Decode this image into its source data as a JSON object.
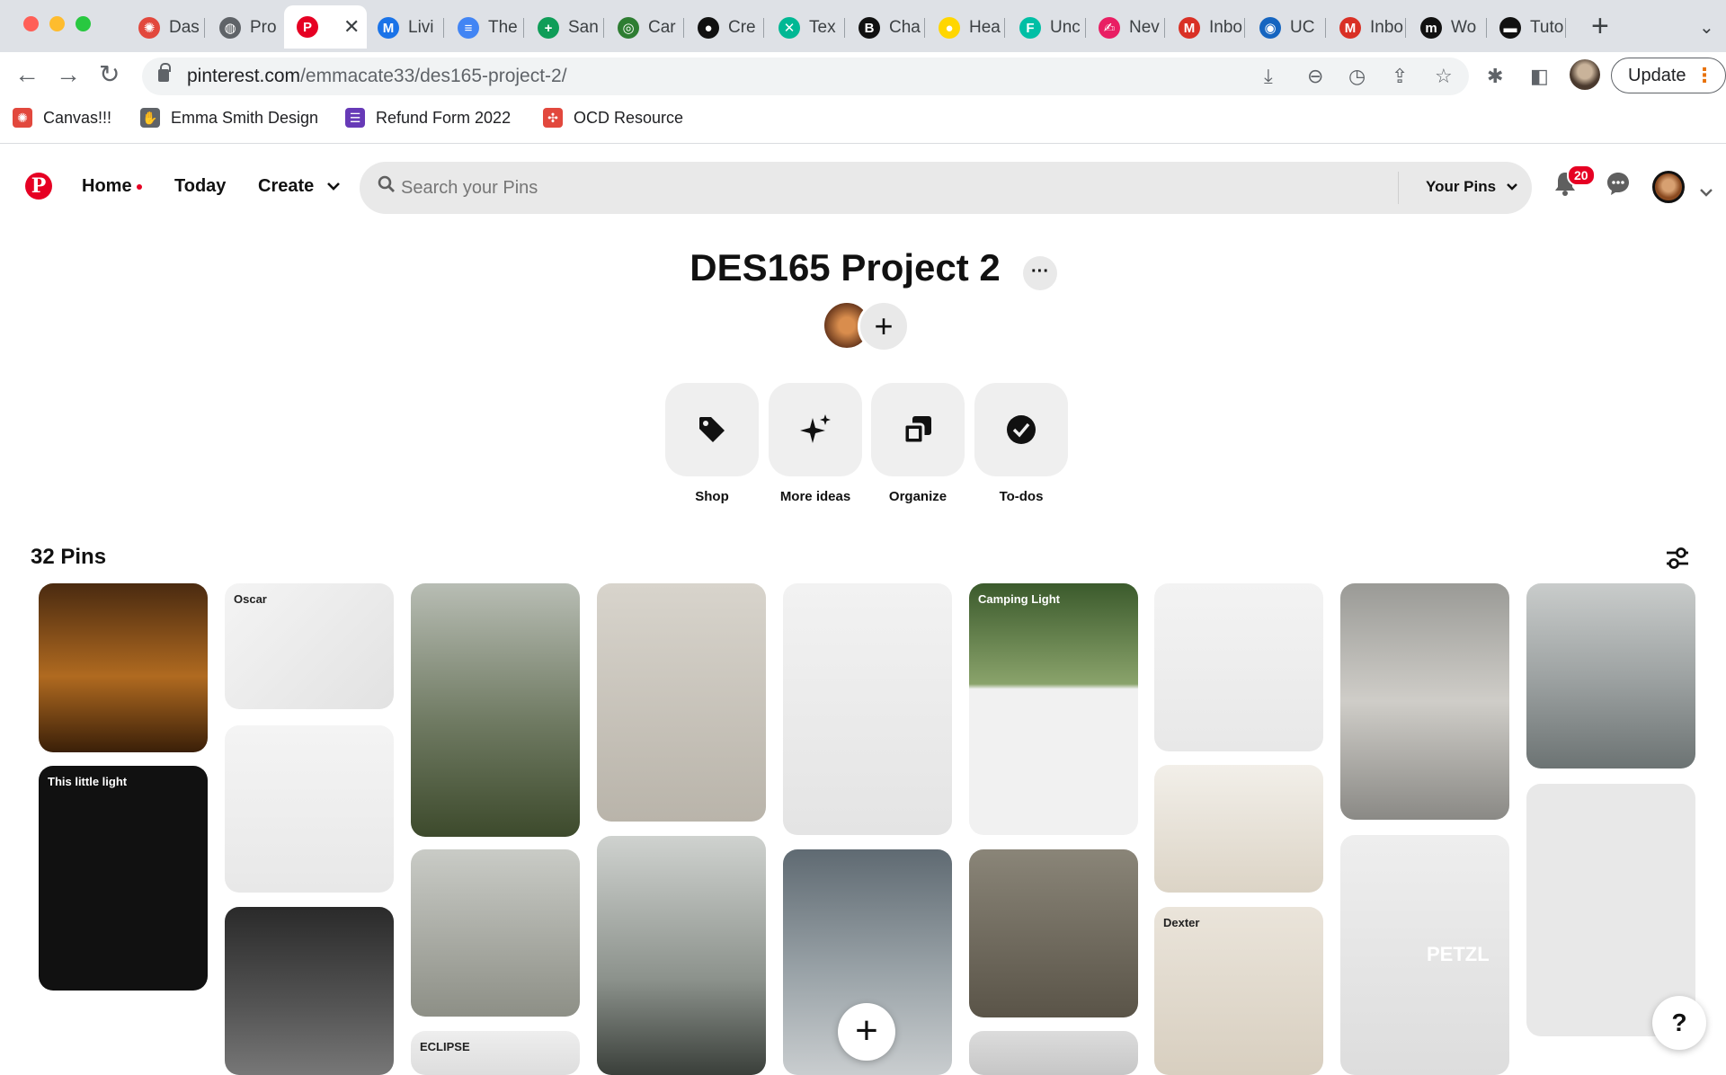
{
  "browser": {
    "tabs": [
      {
        "label": "Das",
        "color": "#e2483d",
        "glyph": "✺"
      },
      {
        "label": "Pro",
        "color": "#5f6368",
        "glyph": "◍"
      },
      {
        "label": "",
        "color": "#e60023",
        "glyph": "P",
        "active": true
      },
      {
        "label": "Livi",
        "color": "#1a73e8",
        "glyph": "M"
      },
      {
        "label": "The",
        "color": "#4285f4",
        "glyph": "≡"
      },
      {
        "label": "San",
        "color": "#0f9d58",
        "glyph": "+"
      },
      {
        "label": "Car",
        "color": "#2e7d32",
        "glyph": "◎"
      },
      {
        "label": "Cre",
        "color": "#111111",
        "glyph": "●"
      },
      {
        "label": "Tex",
        "color": "#00b894",
        "glyph": "✕"
      },
      {
        "label": "Cha",
        "color": "#111111",
        "glyph": "B"
      },
      {
        "label": "Hea",
        "color": "#ffd600",
        "glyph": "●"
      },
      {
        "label": "Unc",
        "color": "#00bfa5",
        "glyph": "F"
      },
      {
        "label": "Nev",
        "color": "#e91e63",
        "glyph": "✍"
      },
      {
        "label": "Inbo",
        "color": "#d93025",
        "glyph": "M"
      },
      {
        "label": "UC",
        "color": "#1565c0",
        "glyph": "◉"
      },
      {
        "label": "Inbo",
        "color": "#d93025",
        "glyph": "M"
      },
      {
        "label": "Wo",
        "color": "#111111",
        "glyph": "m"
      },
      {
        "label": "Tuto",
        "color": "#111111",
        "glyph": "▬"
      }
    ],
    "active_tab_close": "✕",
    "new_tab": "+",
    "tab_search": "⌄",
    "url_host": "pinterest.com",
    "url_path": "/emmacate33/des165-project-2/",
    "update_label": "Update",
    "update_dots": "⋮",
    "bookmarks": [
      {
        "label": "Canvas!!!",
        "icon": "canvas-icon",
        "color": "#e2483d",
        "glyph": "✺"
      },
      {
        "label": "Emma Smith Design",
        "icon": "hand-icon",
        "color": "#5f6368",
        "glyph": "✋"
      },
      {
        "label": "Refund Form 2022",
        "icon": "form-icon",
        "color": "#673ab7",
        "glyph": "☰"
      },
      {
        "label": "OCD Resource",
        "icon": "dots-icon",
        "color": "#e2483d",
        "glyph": "✣"
      }
    ]
  },
  "header": {
    "logo": "P",
    "nav": {
      "home": "Home",
      "today": "Today",
      "create": "Create"
    },
    "search_placeholder": "Search your Pins",
    "your_pins": "Your Pins",
    "notification_count": "20"
  },
  "board": {
    "title": "DES165 Project 2",
    "more": "···",
    "add_collaborator": "+",
    "actions": [
      {
        "label": "Shop",
        "icon": "tag-icon"
      },
      {
        "label": "More ideas",
        "icon": "sparkle-icon"
      },
      {
        "label": "Organize",
        "icon": "organize-icon"
      },
      {
        "label": "To-dos",
        "icon": "check-circle-icon"
      }
    ],
    "pins_count": "32 Pins"
  },
  "pins": [
    {
      "name": "pin-glowing-egg-lamp",
      "bg": "linear-gradient(180deg,#4a2a10,#b06a20 55%,#3a1f08)"
    },
    {
      "name": "pin-firefly-infographic",
      "bg": "#111111",
      "text": "This little light"
    },
    {
      "name": "pin-oscar-lamp-sheet",
      "bg": "linear-gradient(135deg,#f4f4f4,#e2e2e2)",
      "text": "Oscar"
    },
    {
      "name": "pin-green-glass-lamp",
      "bg": "linear-gradient(180deg,#f4f4f4,#e8e8e8)"
    },
    {
      "name": "pin-dome-glass-lamp",
      "bg": "linear-gradient(180deg,#2a2a2a,#555 60%,#777)"
    },
    {
      "name": "pin-hand-held-lantern-forest",
      "bg": "linear-gradient(180deg,#b8bdb4,#6f7a62 55%,#3d4a2c)"
    },
    {
      "name": "pin-lamp-on-side-table",
      "bg": "linear-gradient(180deg,#c9cbc6,#8d8f86)"
    },
    {
      "name": "pin-eclipse-lamp-board",
      "bg": "linear-gradient(180deg,#eeeeee,#dddddd)",
      "text": "ECLIPSE"
    },
    {
      "name": "pin-red-clip-table",
      "bg": "linear-gradient(180deg,#d8d4cc,#b9b4aa)"
    },
    {
      "name": "pin-collapsible-lantern-hand",
      "bg": "linear-gradient(180deg,#cfd2cf,#8c928c 60%,#3a3f3a)"
    },
    {
      "name": "pin-hanging-lantern",
      "bg": "linear-gradient(180deg,#f2f2f2,#e4e4e4)"
    },
    {
      "name": "pin-terracotta-lamp",
      "bg": "linear-gradient(180deg,#5f6a72,#9aa3a8 55%,#c9cdcf)"
    },
    {
      "name": "pin-camping-light",
      "bg": "linear-gradient(180deg,#3b5a2c,#8aa36b 40%,#f1f1f1 42%)",
      "text": "Camping Light"
    },
    {
      "name": "pin-desk-lamp-partial",
      "bg": "linear-gradient(180deg,#8a8578,#5a5448)"
    },
    {
      "name": "pin-mushroom-table-lamp",
      "bg": "linear-gradient(180deg,#dcdcdc,#c6c6c6)"
    },
    {
      "name": "pin-edison-bulb-wood-lamp",
      "bg": "linear-gradient(180deg,#f3f3f3,#e8e8e8)"
    },
    {
      "name": "pin-window-globe-lamp",
      "bg": "linear-gradient(180deg,#f2efe9,#dcd4c6)"
    },
    {
      "name": "pin-dexter-sled-sheet",
      "bg": "linear-gradient(180deg,#eae4da,#d8cfc0)",
      "text": "Dexter"
    },
    {
      "name": "pin-lamp-sketches-desk",
      "bg": "linear-gradient(180deg,#9a9a96,#cfcdc8 50%,#8a8985)"
    },
    {
      "name": "pin-petzl-lantern",
      "bg": "linear-gradient(180deg,#eeeeee,#dddddd)",
      "text": "PETZL"
    },
    {
      "name": "pin-lantern-hand-lake",
      "bg": "linear-gradient(180deg,#c9cccb,#9ea3a3 50%,#6c7373)"
    },
    {
      "name": "pin-partial-bottom",
      "bg": "#e8e8e8"
    }
  ],
  "fab": "+",
  "help": "?"
}
